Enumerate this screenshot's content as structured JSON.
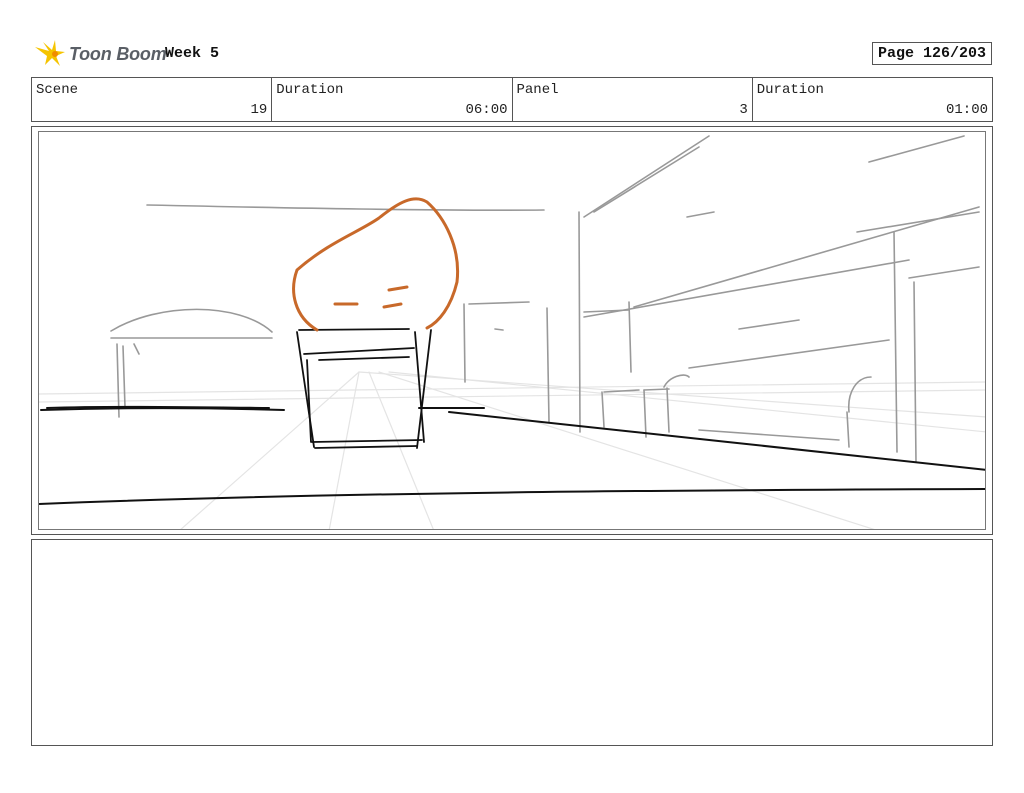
{
  "header": {
    "logo_text": "Toon Boom",
    "logo_icon": "toon-boom-star-icon",
    "project": "Week 5",
    "page": "Page 126/203"
  },
  "info": {
    "scene_label": "Scene",
    "scene_value": "19",
    "duration_label": "Duration",
    "duration_value": "06:00",
    "panel_label": "Panel",
    "panel_value": "3",
    "panel_duration_label": "Duration",
    "panel_duration_value": "01:00"
  },
  "colors": {
    "logo_accent": "#f5c400",
    "sketch_orange": "#c8692a",
    "sketch_black": "#111111",
    "sketch_gray": "#9a9a9a"
  }
}
